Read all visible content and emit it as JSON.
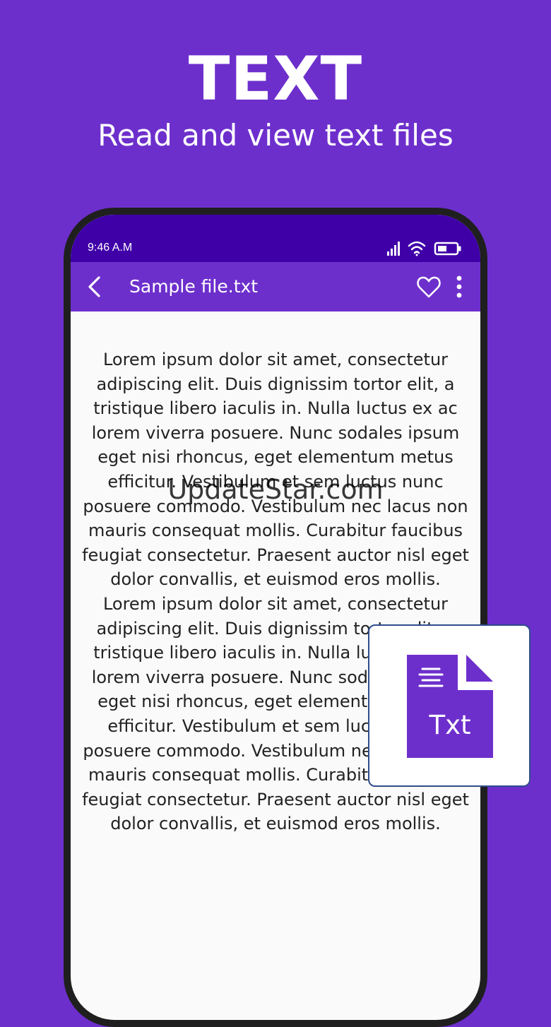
{
  "hero": {
    "title": "TEXT",
    "subtitle": "Read and view text files"
  },
  "status_bar": {
    "time": "9:46 A.M",
    "icons": [
      "signal-icon",
      "wifi-icon",
      "battery-icon"
    ]
  },
  "app_bar": {
    "title": "Sample file.txt",
    "icons": [
      "back-icon",
      "heart-icon",
      "more-icon"
    ]
  },
  "content": {
    "paragraph_1": "Lorem ipsum dolor sit amet, consectetur adipiscing elit. Duis dignissim tortor elit, a tristique libero iaculis in. Nulla luctus ex ac lorem viverra posuere. Nunc sodales ipsum eget nisi rhoncus, eget elementum metus efficitur. Vestibulum et sem luctus nunc posuere commodo. Vestibulum nec lacus non mauris consequat mollis. Curabitur faucibus feugiat consectetur. Praesent auctor nisl eget dolor convallis, et euismod eros mollis.",
    "paragraph_2": "Lorem ipsum dolor sit amet, consectetur adipiscing elit. Duis dignissim tortor elit, a tristique libero iaculis in. Nulla luctus ex ac lorem viverra posuere. Nunc sodales ipsum eget nisi rhoncus, eget elementum metus efficitur. Vestibulum et sem luctus nunc posuere commodo. Vestibulum nec lacus non mauris consequat mollis. Curabitur faucibus feugiat consectetur. Praesent auctor nisl eget dolor convallis, et euismod eros mollis."
  },
  "watermark": "UpdateStar.com",
  "file_badge": {
    "label": "Txt",
    "icon": "txt-file-icon"
  },
  "colors": {
    "background": "#6d2fcc",
    "status_bar": "#3f00a8",
    "app_bar": "#6d2fcc",
    "file_icon": "#6d2fcc",
    "text": "#222222"
  }
}
